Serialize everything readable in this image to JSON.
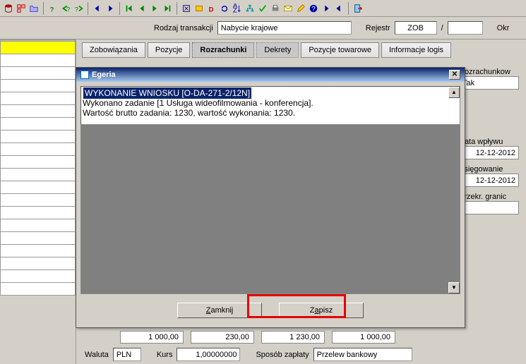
{
  "header": {
    "rodzaj_label": "Rodzaj transakcji",
    "rodzaj_value": "Nabycie krajowe",
    "rejestr_label": "Rejestr",
    "rejestr_value": "ZOB",
    "slash": "/",
    "okr_label": "Okr"
  },
  "tabs": [
    {
      "label": "Zobowiązania"
    },
    {
      "label": "Pozycje"
    },
    {
      "label": "Rozrachunki"
    },
    {
      "label": "Dekrety"
    },
    {
      "label": "Pozycje towarowe"
    },
    {
      "label": "Informacje logis"
    }
  ],
  "right": {
    "rozrach_label": "Rozrachunkow",
    "rozrach_value": "Tak",
    "data_wp_label": "Data wpływu",
    "data_wp_value": "12-12-2012",
    "ksieg_label": "Księgowanie",
    "ksieg_value": "12-12-2012",
    "przekr_label": "Przekr. granic"
  },
  "bottom": {
    "n1": "1 000,00",
    "n2": "230,00",
    "n3": "1 230,00",
    "n4": "1 000,00",
    "waluta_label": "Waluta",
    "waluta_value": "PLN",
    "kurs_label": "Kurs",
    "kurs_value": "1,00000000",
    "sposob_label": "Sposób zapłaty",
    "sposob_value": "Przelew bankowy"
  },
  "dialog": {
    "title": "Egeria",
    "msg_head": "WYKONANIE WNIOSKU [O-DA-271-2/12N]",
    "msg_line1": "Wykonano zadanie [1 Usługa wideofilmowania - konferencja].",
    "msg_line2": "Wartość brutto zadania: 1230, wartość wykonania: 1230.",
    "btn_zamknij": "Zamknij",
    "btn_zapisz": "Zapisz"
  }
}
